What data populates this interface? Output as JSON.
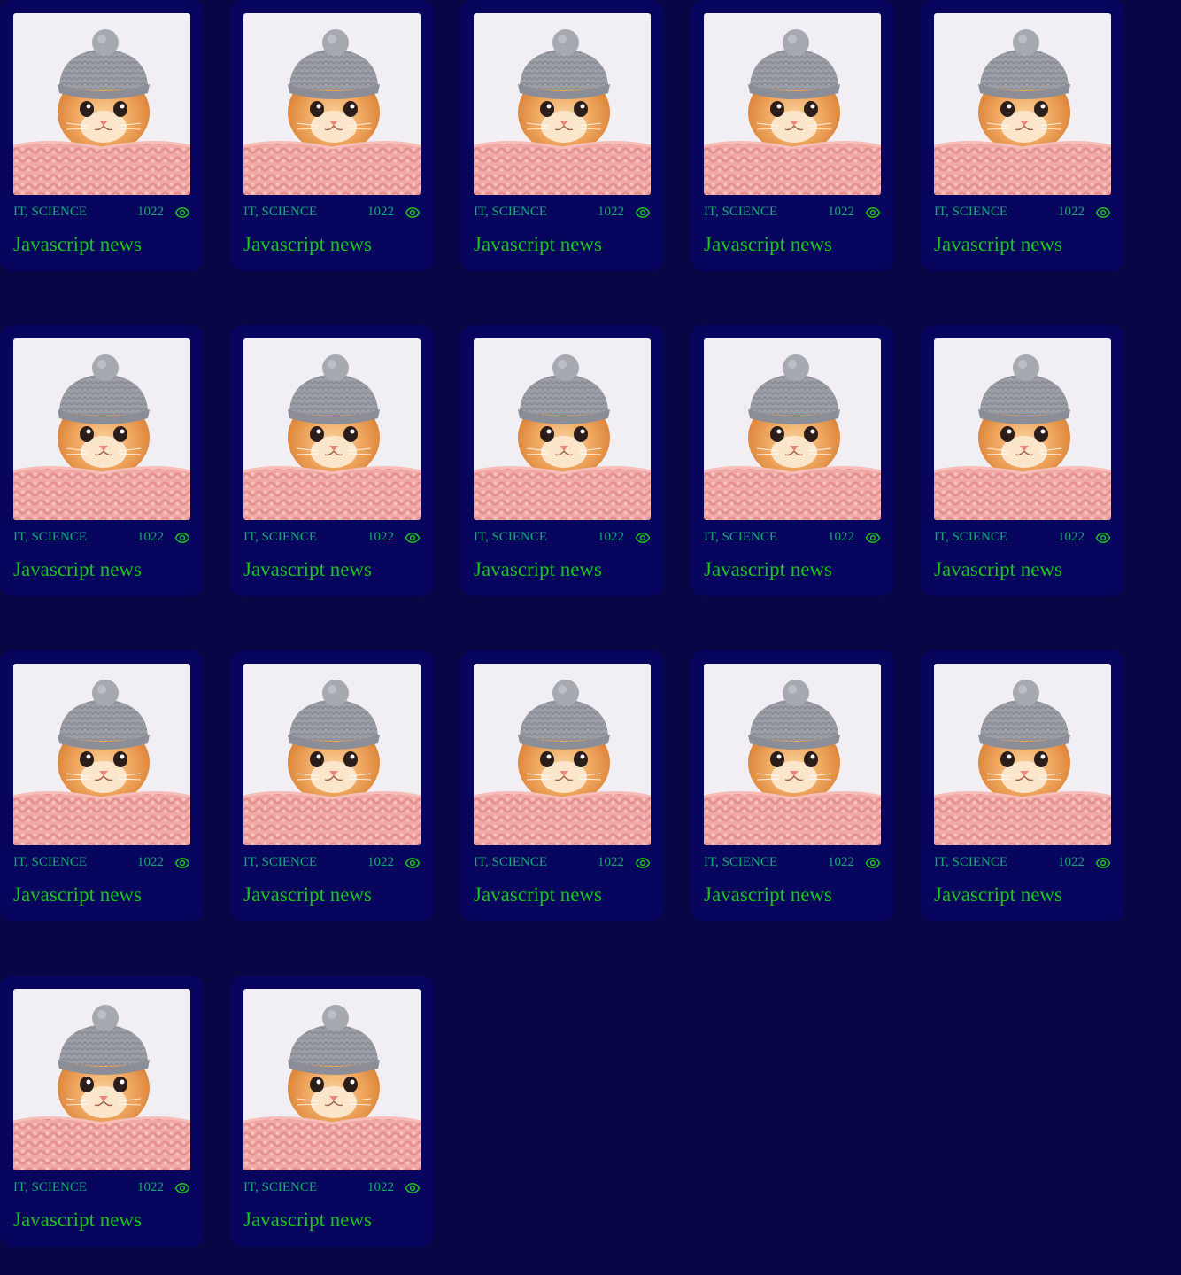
{
  "colors": {
    "page_background": "#080745",
    "card_background": "#07055e",
    "meta_text": "#15a872",
    "title_text": "#1bc31b"
  },
  "icons": {
    "views": "eye-icon"
  },
  "cards": [
    {
      "tags": "IT, SCIENCE",
      "views": "1022",
      "title": "Javascript news",
      "image": "kitten-in-gray-knit-hat"
    },
    {
      "tags": "IT, SCIENCE",
      "views": "1022",
      "title": "Javascript news",
      "image": "kitten-in-gray-knit-hat"
    },
    {
      "tags": "IT, SCIENCE",
      "views": "1022",
      "title": "Javascript news",
      "image": "kitten-in-gray-knit-hat"
    },
    {
      "tags": "IT, SCIENCE",
      "views": "1022",
      "title": "Javascript news",
      "image": "kitten-in-gray-knit-hat"
    },
    {
      "tags": "IT, SCIENCE",
      "views": "1022",
      "title": "Javascript news",
      "image": "kitten-in-gray-knit-hat"
    },
    {
      "tags": "IT, SCIENCE",
      "views": "1022",
      "title": "Javascript news",
      "image": "kitten-in-gray-knit-hat"
    },
    {
      "tags": "IT, SCIENCE",
      "views": "1022",
      "title": "Javascript news",
      "image": "kitten-in-gray-knit-hat"
    },
    {
      "tags": "IT, SCIENCE",
      "views": "1022",
      "title": "Javascript news",
      "image": "kitten-in-gray-knit-hat"
    },
    {
      "tags": "IT, SCIENCE",
      "views": "1022",
      "title": "Javascript news",
      "image": "kitten-in-gray-knit-hat"
    },
    {
      "tags": "IT, SCIENCE",
      "views": "1022",
      "title": "Javascript news",
      "image": "kitten-in-gray-knit-hat"
    },
    {
      "tags": "IT, SCIENCE",
      "views": "1022",
      "title": "Javascript news",
      "image": "kitten-in-gray-knit-hat"
    },
    {
      "tags": "IT, SCIENCE",
      "views": "1022",
      "title": "Javascript news",
      "image": "kitten-in-gray-knit-hat"
    },
    {
      "tags": "IT, SCIENCE",
      "views": "1022",
      "title": "Javascript news",
      "image": "kitten-in-gray-knit-hat"
    },
    {
      "tags": "IT, SCIENCE",
      "views": "1022",
      "title": "Javascript news",
      "image": "kitten-in-gray-knit-hat"
    },
    {
      "tags": "IT, SCIENCE",
      "views": "1022",
      "title": "Javascript news",
      "image": "kitten-in-gray-knit-hat"
    },
    {
      "tags": "IT, SCIENCE",
      "views": "1022",
      "title": "Javascript news",
      "image": "kitten-in-gray-knit-hat"
    },
    {
      "tags": "IT, SCIENCE",
      "views": "1022",
      "title": "Javascript news",
      "image": "kitten-in-gray-knit-hat"
    }
  ]
}
